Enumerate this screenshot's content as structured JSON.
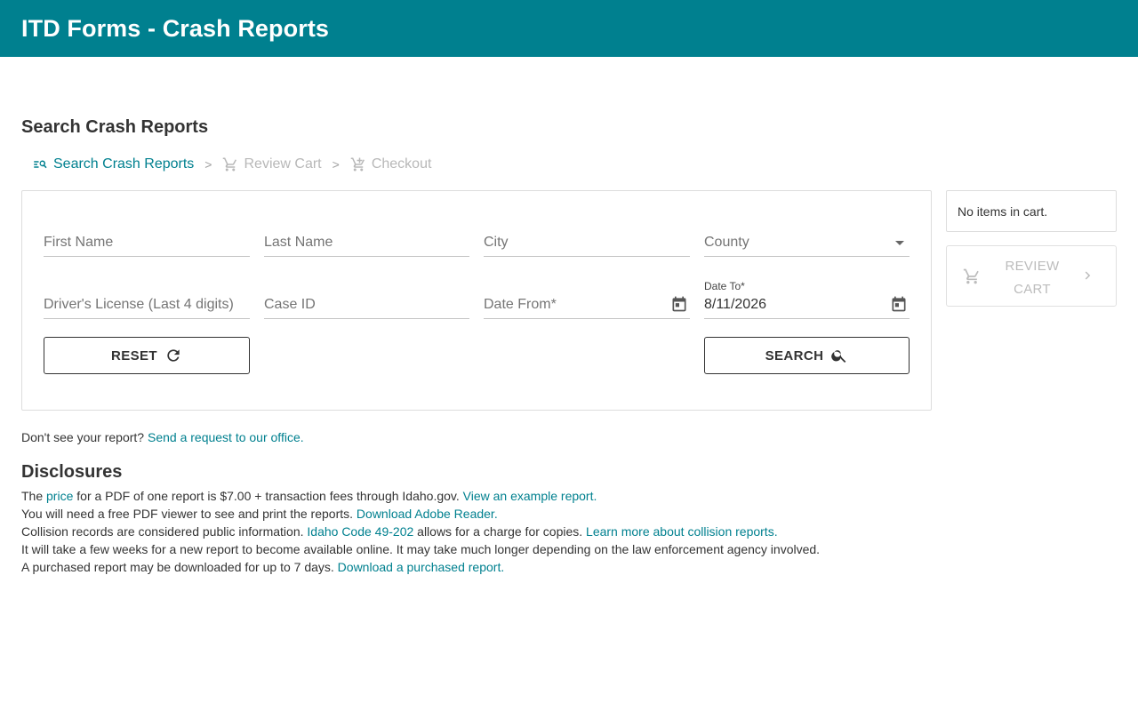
{
  "header": {
    "title": "ITD Forms - Crash Reports"
  },
  "page": {
    "title": "Search Crash Reports"
  },
  "steps": [
    {
      "label": "Search Crash Reports",
      "icon": "search-list-icon"
    },
    {
      "label": "Review Cart",
      "icon": "cart-icon"
    },
    {
      "label": "Checkout",
      "icon": "cart-checkout-icon"
    }
  ],
  "step_separator": ">",
  "form": {
    "first_name": {
      "placeholder": "First Name",
      "value": ""
    },
    "last_name": {
      "placeholder": "Last Name",
      "value": ""
    },
    "city": {
      "placeholder": "City",
      "value": ""
    },
    "county": {
      "placeholder": "County",
      "value": ""
    },
    "drivers_license": {
      "placeholder": "Driver's License (Last 4 digits)",
      "value": ""
    },
    "case_id": {
      "placeholder": "Case ID",
      "value": ""
    },
    "date_from": {
      "placeholder": "Date From*",
      "value": ""
    },
    "date_to": {
      "label": "Date To*",
      "value": "8/11/2026"
    },
    "reset_label": "RESET",
    "search_label": "SEARCH"
  },
  "cart": {
    "empty_text": "No items in cart.",
    "review_label_line1": "REVIEW",
    "review_label_line2": "CART"
  },
  "request": {
    "text": "Don't see your report?",
    "link": "Send a request to our office."
  },
  "disclosures": {
    "title": "Disclosures",
    "line1": {
      "a": "The",
      "link1": "price",
      "b": "for a PDF of one report is $7.00 + transaction fees through Idaho.gov.",
      "link2": "View an example report."
    },
    "line2": {
      "a": "You will need a free PDF viewer to see and print the reports.",
      "link1": "Download Adobe Reader."
    },
    "line3": {
      "a": "Collision records are considered public information.",
      "link1": "Idaho Code 49-202",
      "b": "allows for a charge for copies.",
      "link2": "Learn more about collision reports."
    },
    "line4": {
      "a": "It will take a few weeks for a new report to become available online. It may take much longer depending on the law enforcement agency involved."
    },
    "line5": {
      "a": "A purchased report may be downloaded for up to 7 days.",
      "link1": "Download a purchased report."
    }
  },
  "colors": {
    "brand": "#00808f",
    "disabled": "#bcbcbc"
  }
}
